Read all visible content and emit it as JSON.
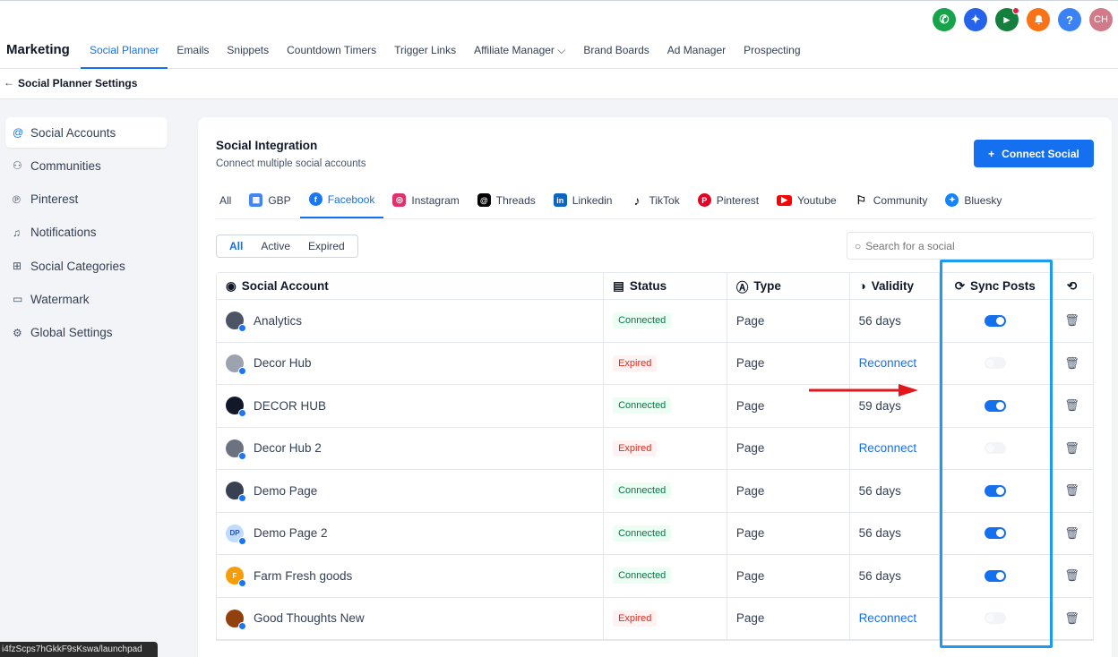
{
  "header": {
    "brand": "Marketing",
    "nav": [
      "Social Planner",
      "Emails",
      "Snippets",
      "Countdown Timers",
      "Trigger Links",
      "Affiliate Manager",
      "Brand Boards",
      "Ad Manager",
      "Prospecting"
    ],
    "affiliate_caret": "⌵",
    "avatar_initials": "CH",
    "icons": [
      {
        "name": "phone-icon",
        "glyph": "✆",
        "color": "#16a34a"
      },
      {
        "name": "sparkle-icon",
        "glyph": "✦",
        "color": "#2563eb"
      },
      {
        "name": "megaphone-icon",
        "glyph": "📢",
        "color": "#15803d"
      },
      {
        "name": "bell-icon",
        "glyph": "🔔",
        "color": "#f97316"
      },
      {
        "name": "help-icon",
        "glyph": "?",
        "color": "#3b82f6"
      }
    ]
  },
  "subheader": {
    "back": "←",
    "title": "Social Planner Settings"
  },
  "sidebar": {
    "items": [
      {
        "label": "Social Accounts",
        "icon": "@"
      },
      {
        "label": "Communities",
        "icon": "⚇"
      },
      {
        "label": "Pinterest",
        "icon": "℗"
      },
      {
        "label": "Notifications",
        "icon": "♫"
      },
      {
        "label": "Social Categories",
        "icon": "⊞"
      },
      {
        "label": "Watermark",
        "icon": "▭"
      },
      {
        "label": "Global Settings",
        "icon": "⚙"
      }
    ]
  },
  "main": {
    "title": "Social Integration",
    "subtitle": "Connect multiple social accounts",
    "connect_label": "Connect Social",
    "connect_icon": "+",
    "platform_tabs": [
      {
        "label": "All"
      },
      {
        "label": "GBP"
      },
      {
        "label": "Facebook"
      },
      {
        "label": "Instagram"
      },
      {
        "label": "Threads"
      },
      {
        "label": "Linkedin"
      },
      {
        "label": "TikTok"
      },
      {
        "label": "Pinterest"
      },
      {
        "label": "Youtube"
      },
      {
        "label": "Community"
      },
      {
        "label": "Bluesky"
      }
    ],
    "filters": [
      "All",
      "Active",
      "Expired"
    ],
    "search_placeholder": "Search for a social",
    "search_glyph": "○",
    "columns": {
      "account": "Social Account",
      "status": "Status",
      "type": "Type",
      "validity": "Validity",
      "sync": "Sync Posts"
    },
    "rows": [
      {
        "name": "Analytics",
        "status": "Connected",
        "type": "Page",
        "validity": "56 days",
        "sync": true
      },
      {
        "name": "Decor Hub",
        "status": "Expired",
        "type": "Page",
        "validity": "Reconnect",
        "sync": false
      },
      {
        "name": "DECOR HUB",
        "status": "Connected",
        "type": "Page",
        "validity": "59 days",
        "sync": true
      },
      {
        "name": "Decor Hub 2",
        "status": "Expired",
        "type": "Page",
        "validity": "Reconnect",
        "sync": false
      },
      {
        "name": "Demo Page",
        "status": "Connected",
        "type": "Page",
        "validity": "56 days",
        "sync": true
      },
      {
        "name": "Demo Page 2",
        "status": "Connected",
        "type": "Page",
        "validity": "56 days",
        "sync": true,
        "initials": "DP"
      },
      {
        "name": "Farm Fresh goods",
        "status": "Connected",
        "type": "Page",
        "validity": "56 days",
        "sync": true,
        "initials": "F"
      },
      {
        "name": "Good Thoughts New",
        "status": "Expired",
        "type": "Page",
        "validity": "Reconnect",
        "sync": false
      }
    ]
  },
  "statusbar": {
    "url": "i4fzScps7hGkkF9sKswa/launchpad"
  }
}
